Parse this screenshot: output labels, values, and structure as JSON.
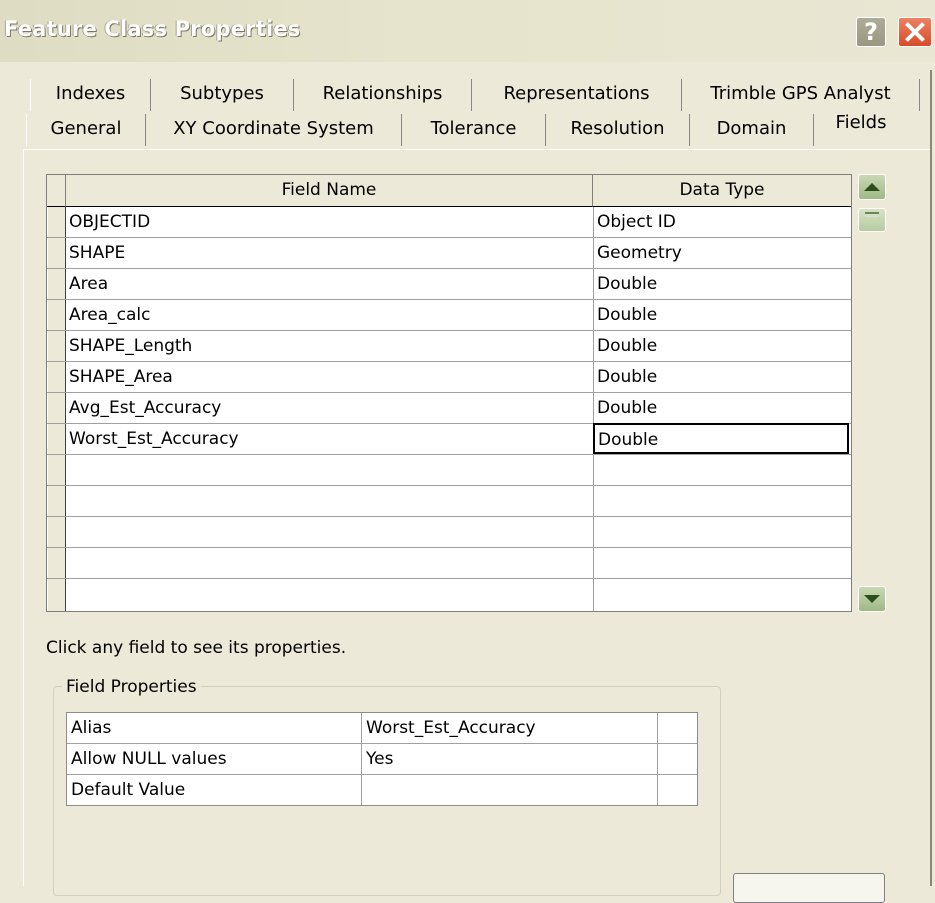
{
  "window": {
    "title": "Feature Class Properties"
  },
  "tabs_row1": [
    "Indexes",
    "Subtypes",
    "Relationships",
    "Representations",
    "Trimble GPS Analyst"
  ],
  "tabs_row2": [
    "General",
    "XY Coordinate System",
    "Tolerance",
    "Resolution",
    "Domain",
    "Fields"
  ],
  "selected_tab": "Fields",
  "grid": {
    "headers": {
      "name": "Field Name",
      "type": "Data Type"
    },
    "rows": [
      {
        "name": "OBJECTID",
        "type": "Object ID"
      },
      {
        "name": "SHAPE",
        "type": "Geometry"
      },
      {
        "name": "Area",
        "type": "Double"
      },
      {
        "name": "Area_calc",
        "type": "Double"
      },
      {
        "name": "SHAPE_Length",
        "type": "Double"
      },
      {
        "name": "SHAPE_Area",
        "type": "Double"
      },
      {
        "name": "Avg_Est_Accuracy",
        "type": "Double"
      },
      {
        "name": "Worst_Est_Accuracy",
        "type": "Double"
      }
    ],
    "active_row": 7
  },
  "hint": "Click any field to see its properties.",
  "field_properties": {
    "label": "Field Properties",
    "rows": [
      {
        "key": "Alias",
        "value": "Worst_Est_Accuracy"
      },
      {
        "key": "Allow NULL values",
        "value": "Yes"
      },
      {
        "key": "Default Value",
        "value": ""
      }
    ]
  }
}
